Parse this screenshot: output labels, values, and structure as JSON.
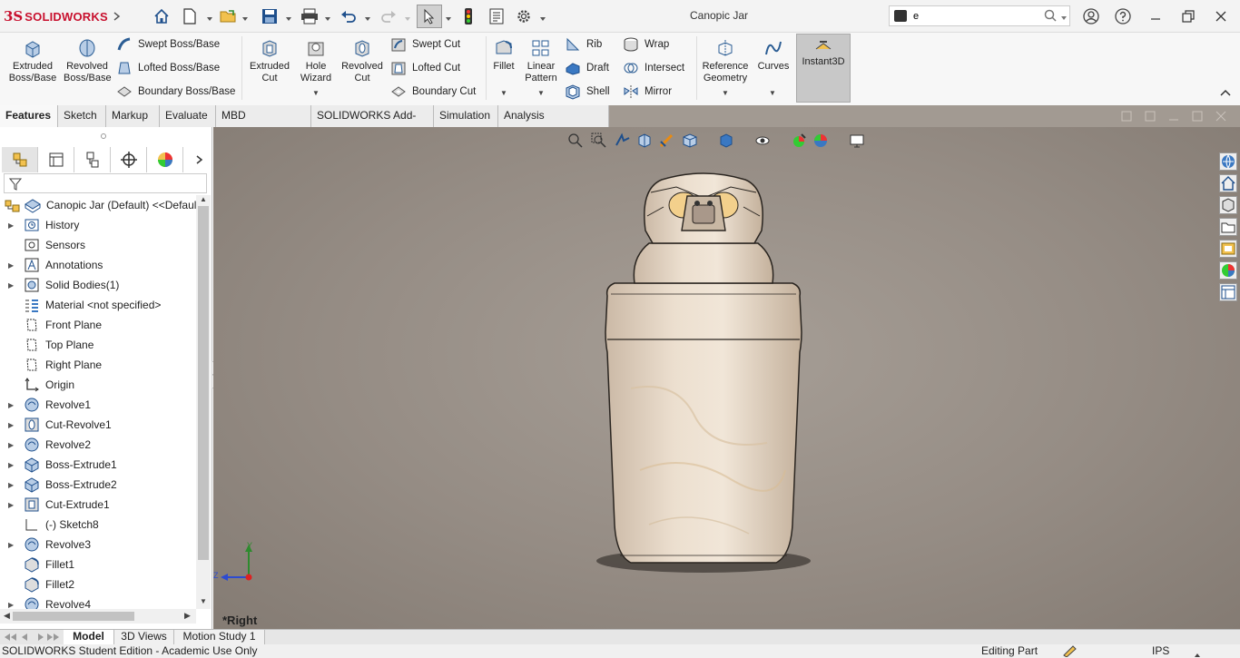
{
  "app": {
    "brand_ds": "3S",
    "brand_name": "SOLIDWORKS",
    "document_title": "Canopic Jar"
  },
  "search": {
    "value": "e"
  },
  "ribbon": {
    "extruded_boss": "Extruded Boss/Base",
    "revolved_boss": "Revolved Boss/Base",
    "swept_boss": "Swept Boss/Base",
    "lofted_boss": "Lofted Boss/Base",
    "boundary_boss": "Boundary Boss/Base",
    "extruded_cut": "Extruded Cut",
    "hole_wizard": "Hole Wizard",
    "revolved_cut": "Revolved Cut",
    "swept_cut": "Swept Cut",
    "lofted_cut": "Lofted Cut",
    "boundary_cut": "Boundary Cut",
    "fillet": "Fillet",
    "linear_pattern": "Linear Pattern",
    "rib": "Rib",
    "draft": "Draft",
    "shell": "Shell",
    "wrap": "Wrap",
    "intersect": "Intersect",
    "mirror": "Mirror",
    "reference_geometry": "Reference Geometry",
    "curves": "Curves",
    "instant3d": "Instant3D"
  },
  "tabs": [
    "Features",
    "Sketch",
    "Markup",
    "Evaluate",
    "MBD Dimensions",
    "SOLIDWORKS Add-Ins",
    "Simulation",
    "Analysis Preparation"
  ],
  "tree": {
    "root": "Canopic Jar (Default) <<Defaul",
    "items": [
      {
        "label": "History",
        "icon": "history-icon"
      },
      {
        "label": "Sensors",
        "icon": "sensors-icon"
      },
      {
        "label": "Annotations",
        "icon": "annotations-icon"
      },
      {
        "label": "Solid Bodies(1)",
        "icon": "solid-bodies-icon"
      },
      {
        "label": "Material <not specified>",
        "icon": "material-icon"
      },
      {
        "label": "Front Plane",
        "icon": "plane-icon"
      },
      {
        "label": "Top Plane",
        "icon": "plane-icon"
      },
      {
        "label": "Right Plane",
        "icon": "plane-icon"
      },
      {
        "label": "Origin",
        "icon": "origin-icon"
      },
      {
        "label": "Revolve1",
        "icon": "revolve-icon"
      },
      {
        "label": "Cut-Revolve1",
        "icon": "cut-revolve-icon"
      },
      {
        "label": "Revolve2",
        "icon": "revolve-icon"
      },
      {
        "label": "Boss-Extrude1",
        "icon": "extrude-icon"
      },
      {
        "label": "Boss-Extrude2",
        "icon": "extrude-icon"
      },
      {
        "label": "Cut-Extrude1",
        "icon": "cut-extrude-icon"
      },
      {
        "label": "(-) Sketch8",
        "icon": "sketch-icon"
      },
      {
        "label": "Revolve3",
        "icon": "revolve-icon"
      },
      {
        "label": "Fillet1",
        "icon": "fillet-icon"
      },
      {
        "label": "Fillet2",
        "icon": "fillet-icon"
      },
      {
        "label": "Revolve4",
        "icon": "revolve-icon"
      }
    ]
  },
  "viewport": {
    "view_name": "*Right",
    "triad_y": "Y",
    "triad_z": "Z"
  },
  "bottom_tabs": [
    "Model",
    "3D Views",
    "Motion Study 1"
  ],
  "status": {
    "left": "SOLIDWORKS Student Edition - Academic Use Only",
    "mode": "Editing Part",
    "units": "IPS"
  }
}
